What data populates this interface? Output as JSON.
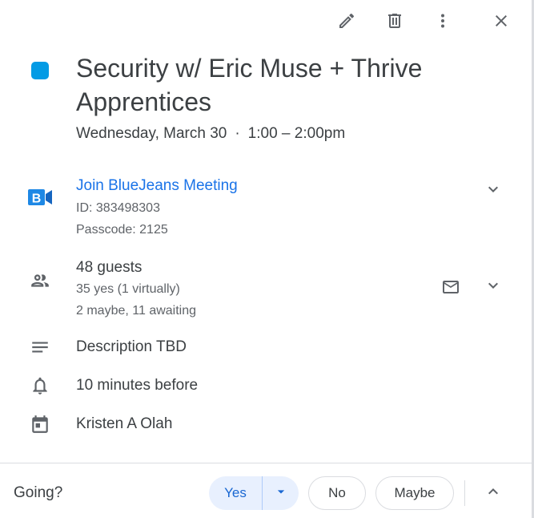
{
  "toolbar": {
    "edit_icon": "pencil-icon",
    "delete_icon": "trash-icon",
    "more_icon": "more-vert-icon",
    "close_icon": "close-icon"
  },
  "event": {
    "color": "#039be5",
    "title": "Security w/ Eric Muse + Thrive Apprentices",
    "date": "Wednesday, March 30",
    "separator": "·",
    "time": "1:00 – 2:00pm"
  },
  "conference": {
    "icon": "bluejeans-icon",
    "link_label": "Join BlueJeans Meeting",
    "meeting_id": "ID: 383498303",
    "passcode": "Passcode: 2125"
  },
  "guests": {
    "icon": "people-icon",
    "count_label": "48 guests",
    "yes_summary": "35 yes (1 virtually)",
    "other_summary": "2 maybe, 11 awaiting",
    "email_icon": "mail-icon"
  },
  "description": {
    "icon": "notes-icon",
    "text": "Description TBD"
  },
  "reminder": {
    "icon": "bell-icon",
    "text": "10 minutes before"
  },
  "calendar": {
    "icon": "calendar-icon",
    "owner": "Kristen A Olah"
  },
  "rsvp": {
    "prompt": "Going?",
    "yes_label": "Yes",
    "no_label": "No",
    "maybe_label": "Maybe",
    "selected": "Yes",
    "accent": "#1967d2"
  }
}
